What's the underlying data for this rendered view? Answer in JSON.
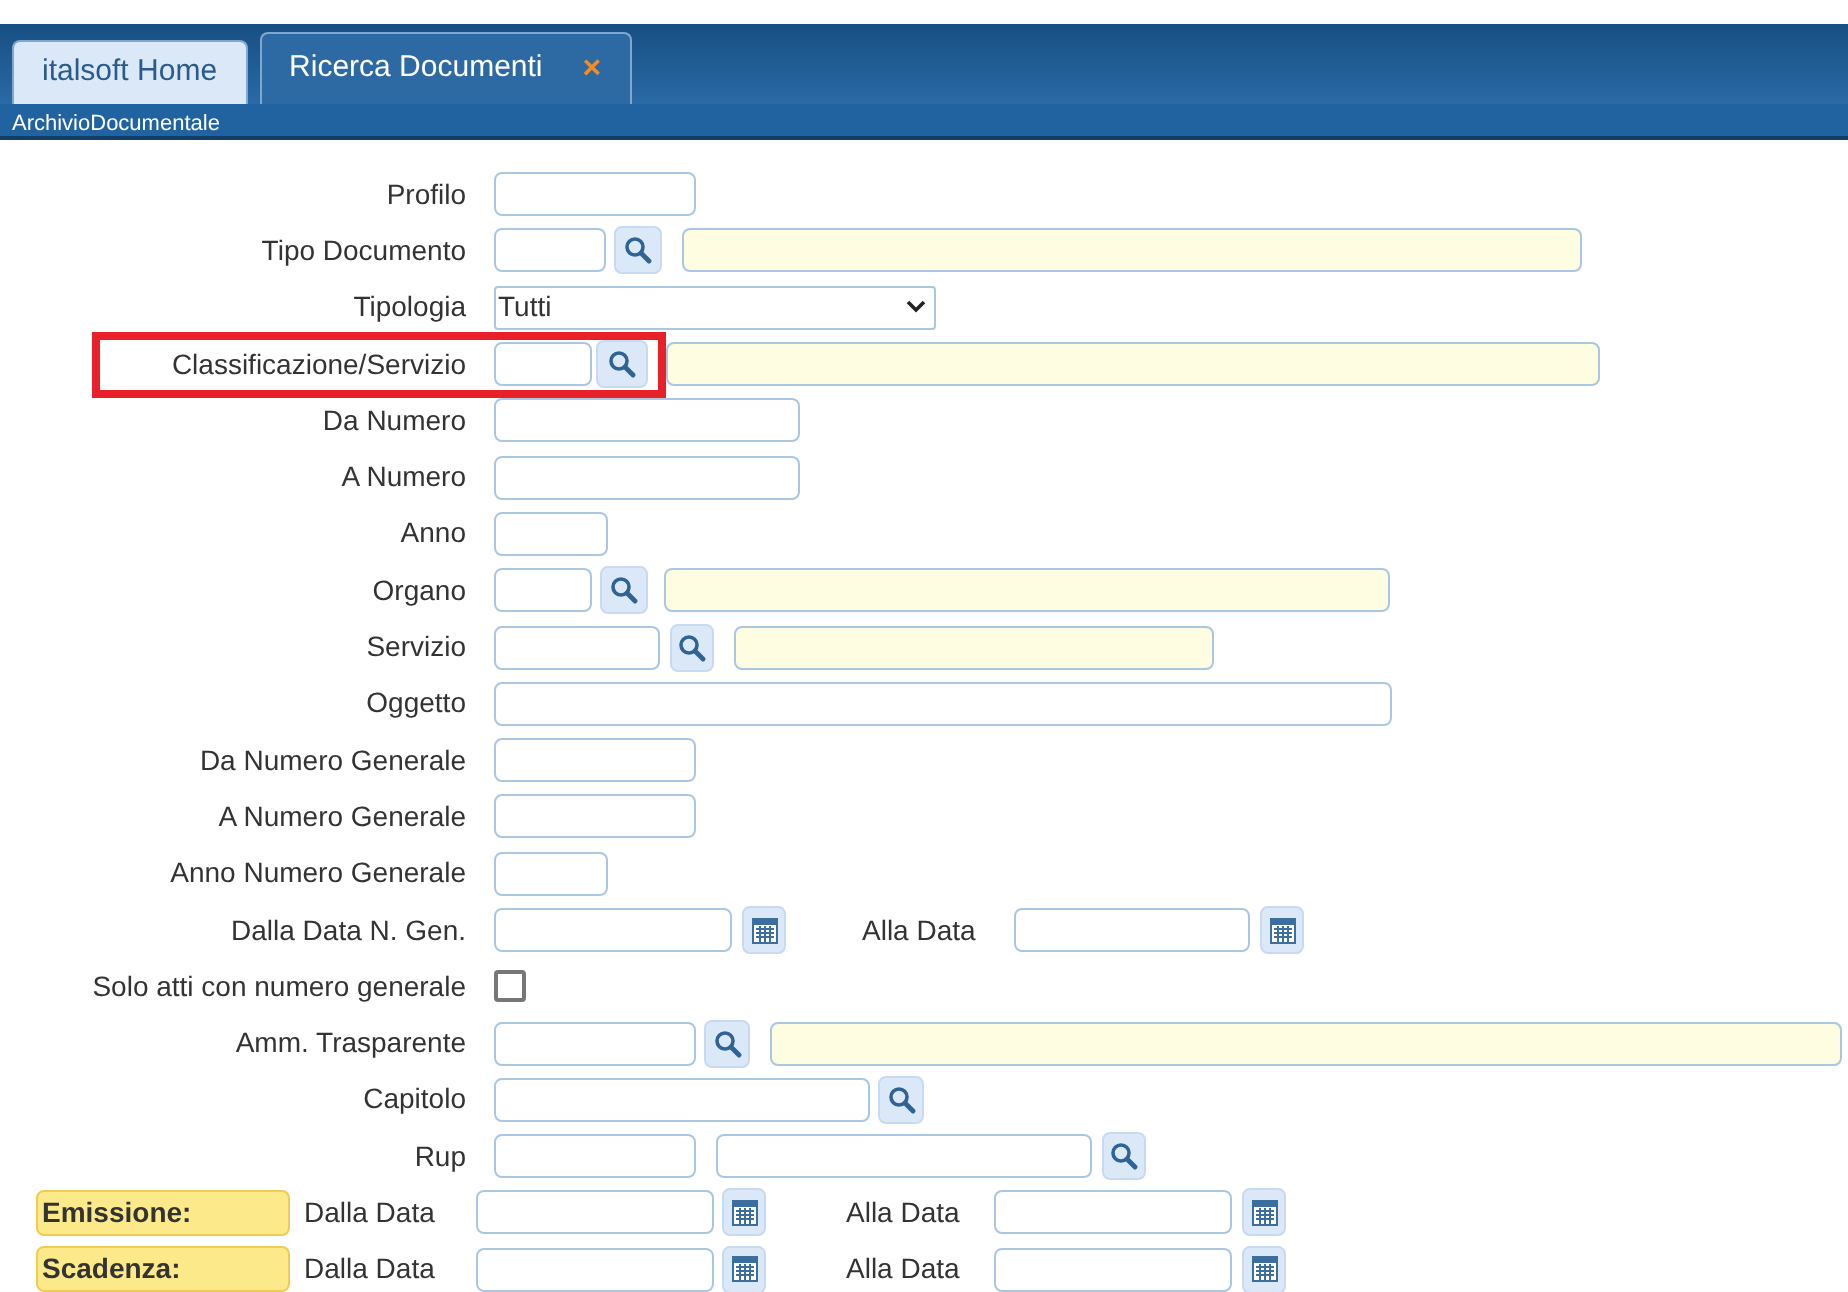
{
  "header": {
    "tabs": [
      {
        "label": "italsoft Home",
        "selected": false
      },
      {
        "label": "Ricerca Documenti",
        "selected": true,
        "close": "×"
      }
    ],
    "breadcrumb": "ArchivioDocumentale"
  },
  "form": {
    "rows": [
      {
        "kind": "field",
        "label": "Profilo",
        "highlighted": false,
        "items": [
          {
            "kind": "input"
          }
        ]
      },
      {
        "kind": "field",
        "label": "Tipo Documento",
        "highlighted": false,
        "items": [
          {
            "kind": "input"
          },
          {
            "kind": "lookup"
          },
          {
            "kind": "readonly"
          }
        ]
      },
      {
        "kind": "field",
        "label": "Tipologia",
        "highlighted": false,
        "items": [
          {
            "kind": "select",
            "value": "Tutti"
          }
        ]
      },
      {
        "kind": "field",
        "label": "Classificazione/Servizio",
        "highlighted": true,
        "items": [
          {
            "kind": "input"
          },
          {
            "kind": "lookup"
          },
          {
            "kind": "readonly"
          }
        ]
      },
      {
        "kind": "field",
        "label": "Da Numero",
        "highlighted": false,
        "items": [
          {
            "kind": "input"
          }
        ]
      },
      {
        "kind": "field",
        "label": "A Numero",
        "highlighted": false,
        "items": [
          {
            "kind": "input"
          }
        ]
      },
      {
        "kind": "field",
        "label": "Anno",
        "highlighted": false,
        "items": [
          {
            "kind": "input"
          }
        ]
      },
      {
        "kind": "field",
        "label": "Organo",
        "highlighted": false,
        "items": [
          {
            "kind": "input"
          },
          {
            "kind": "lookup"
          },
          {
            "kind": "readonly"
          }
        ]
      },
      {
        "kind": "field",
        "label": "Servizio",
        "highlighted": false,
        "items": [
          {
            "kind": "input"
          },
          {
            "kind": "lookup"
          },
          {
            "kind": "readonly"
          }
        ]
      },
      {
        "kind": "field",
        "label": "Oggetto",
        "highlighted": false,
        "items": [
          {
            "kind": "input"
          }
        ]
      },
      {
        "kind": "field",
        "label": "Da Numero Generale",
        "highlighted": false,
        "items": [
          {
            "kind": "input"
          }
        ]
      },
      {
        "kind": "field",
        "label": "A Numero Generale",
        "highlighted": false,
        "items": [
          {
            "kind": "input"
          }
        ]
      },
      {
        "kind": "field",
        "label": "Anno Numero Generale",
        "highlighted": false,
        "items": [
          {
            "kind": "input"
          }
        ]
      },
      {
        "kind": "field",
        "label": "Dalla Data N. Gen.",
        "highlighted": false,
        "items": [
          {
            "kind": "input"
          },
          {
            "kind": "calendar"
          },
          {
            "kind": "text",
            "text": "Alla Data"
          },
          {
            "kind": "input"
          },
          {
            "kind": "calendar"
          }
        ]
      },
      {
        "kind": "field",
        "label": "Solo atti con numero generale",
        "highlighted": false,
        "items": [
          {
            "kind": "checkbox",
            "checked": false
          }
        ]
      },
      {
        "kind": "field",
        "label": "Amm. Trasparente",
        "highlighted": false,
        "items": [
          {
            "kind": "input"
          },
          {
            "kind": "lookup"
          },
          {
            "kind": "readonly"
          }
        ]
      },
      {
        "kind": "field",
        "label": "Capitolo",
        "highlighted": false,
        "items": [
          {
            "kind": "input"
          },
          {
            "kind": "lookup"
          }
        ]
      },
      {
        "kind": "field",
        "label": "Rup",
        "highlighted": false,
        "items": [
          {
            "kind": "input"
          },
          {
            "kind": "input"
          },
          {
            "kind": "lookup"
          }
        ]
      },
      {
        "kind": "section",
        "label": "Emissione:",
        "highlighted": false,
        "items": [
          {
            "kind": "text",
            "text": "Dalla Data"
          },
          {
            "kind": "input"
          },
          {
            "kind": "calendar"
          },
          {
            "kind": "text",
            "text": "Alla Data"
          },
          {
            "kind": "input"
          },
          {
            "kind": "calendar"
          }
        ]
      },
      {
        "kind": "section",
        "label": "Scadenza:",
        "highlighted": false,
        "items": [
          {
            "kind": "text",
            "text": "Dalla Data"
          },
          {
            "kind": "input"
          },
          {
            "kind": "calendar"
          },
          {
            "kind": "text",
            "text": "Alla Data"
          },
          {
            "kind": "input"
          },
          {
            "kind": "calendar"
          }
        ]
      }
    ]
  }
}
